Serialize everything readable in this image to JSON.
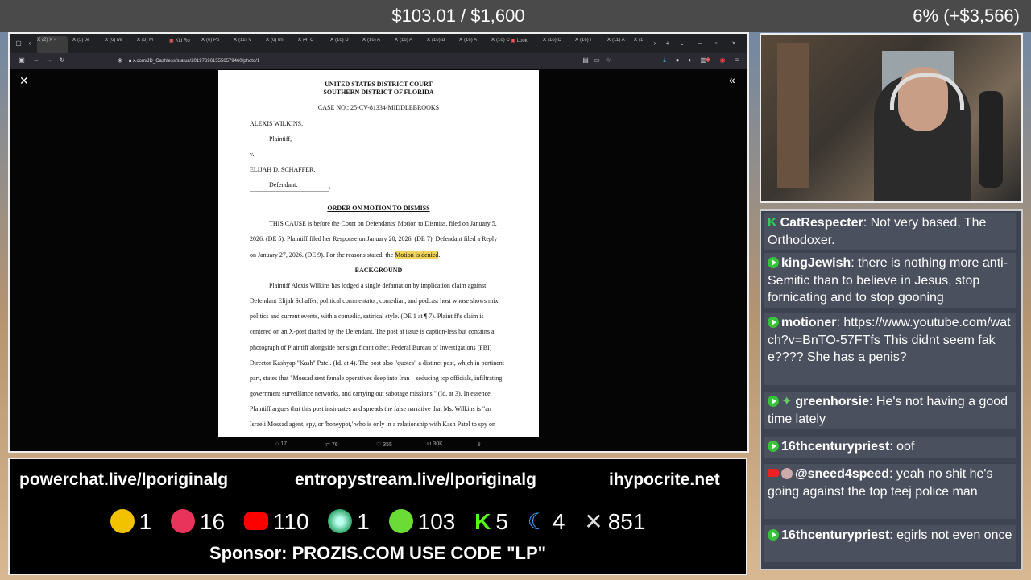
{
  "top_bar": {
    "goal": "$103.01 / $1,600",
    "progress": "6% (+$3,566)"
  },
  "browser": {
    "tabs": [
      "(2) X",
      "(3) Je",
      "(6) Mi",
      "(3) M",
      "Kid Ro",
      "(6) Po",
      "(12) V",
      "(6) Im",
      "(4) C",
      "(16) D",
      "(16) A",
      "(16) A",
      "(16) B",
      "(16) A",
      "(16) C",
      "Look",
      "(16) C",
      "(16) F",
      "(11) A",
      "(1"
    ],
    "url": "x.com/JD_Cashless/status/2019769615556579460/photo/1",
    "actions": {
      "replies": "17",
      "reposts": "76",
      "likes": "355",
      "views": "30K"
    }
  },
  "document": {
    "court_line1": "UNITED STATES DISTRICT COURT",
    "court_line2": "SOUTHERN DISTRICT OF FLORIDA",
    "case_no": "CASE NO.: 25-CV-81334-MIDDLEBROOKS",
    "plaintiff_name": "ALEXIS WILKINS,",
    "plaintiff_label": "Plaintiff,",
    "versus": "v.",
    "defendant_name": "ELIJAH D. SCHAFFER,",
    "defendant_label": "Defendant.",
    "divider": "____________________________/",
    "order_title": "ORDER ON MOTION TO DISMISS",
    "p1_l1": "THIS CAUSE is before the Court on Defendants' Motion to Dismiss, filed on January 5,",
    "p1_l2": "2026. (DE 5). Plaintiff filed her Response on January 20, 2026. (DE 7). Defendant filed a Reply",
    "p1_l3a": "on January 27, 2026. (DE 9). For the reasons stated, the ",
    "p1_l3b": "Motion is denied",
    "p1_l3c": ".",
    "background_title": "BACKGROUND",
    "p2_l1": "Plaintiff Alexis Wilkins has lodged a single defamation by implication claim against",
    "p2_l2": "Defendant Elijah Schaffer, political commentator, comedian, and podcast host whose shows mix",
    "p2_l3": "politics and current events, with a comedic, satirical style. (DE 1 at ¶ 7). Plaintiff's claim is",
    "p2_l4": "centered on an X-post drafted by the Defendant. The post at issue is caption-less but contains a",
    "p2_l5": "photograph of Plaintiff alongside her significant other, Federal Bureau of Investigations (FBI)",
    "p2_l6": "Director Kashyap \"Kash\" Patel. (Id. at 4). The post also \"quotes\" a distinct post, which in pertinent",
    "p2_l7": "part, states that \"Mossad sent female operatives deep into Iran—seducing top officials, infiltrating",
    "p2_l8": "government surveillance networks, and carrying out sabotage missions.\" (Id. at 3). In essence,",
    "p2_l9": "Plaintiff argues that this post insinuates and spreads the false narrative that Ms. Wilkins is \"an",
    "p2_l10": "Israeli Mossad agent, spy, or 'honeypot,' who is only in a relationship with Kash Patel to spy on"
  },
  "chat": [
    {
      "icon": "kick-icon",
      "user": "CatRespecter",
      "text": "Not very based, The Orthodoxer."
    },
    {
      "icon": "rumble-icon",
      "user": "kingJewish",
      "text": "there is nothing more anti-Semitic than to believe in Jesus, stop fornicating and to stop gooning"
    },
    {
      "icon": "rumble-icon",
      "user": "motioner",
      "text": "https://www.youtube.com/watch?v=BnTO-57FTfs This didnt seem fake???? She has a penis?"
    },
    {
      "icon": "rumble-icon",
      "user": "greenhorsie",
      "text": "He's not having a good time lately"
    },
    {
      "icon": "rumble-icon",
      "user": "16thcenturypriest",
      "text": "oof"
    },
    {
      "icon": "youtube-icon",
      "user": "@sneed4speed",
      "text": "yeah no shit he's going against the top teej police man"
    },
    {
      "icon": "rumble-icon",
      "user": "16thcenturypriest",
      "text": "egirls not even once"
    }
  ],
  "panel": {
    "links": [
      "powerchat.live/lporiginalg",
      "entropystream.live/lporiginalg",
      "ihypocrite.net"
    ],
    "stats": [
      {
        "icon": "smiley-icon",
        "color": "#f2c200",
        "count": "1"
      },
      {
        "icon": "pinwheel-icon",
        "color": "#e8345a",
        "count": "16"
      },
      {
        "icon": "youtube-icon",
        "color": "#ff0000",
        "count": "110"
      },
      {
        "icon": "orb-icon",
        "color": "#2fa66a",
        "count": "1"
      },
      {
        "icon": "rumble-icon",
        "color": "#6bdc35",
        "count": "103"
      },
      {
        "icon": "kick-icon",
        "color": "#53fc18",
        "count": "5"
      },
      {
        "icon": "moon-icon",
        "color": "#3aa0ff",
        "count": "4"
      },
      {
        "icon": "x-icon",
        "color": "#ffffff",
        "count": "851"
      }
    ],
    "sponsor": "Sponsor: PROZIS.COM USE CODE \"LP\""
  }
}
